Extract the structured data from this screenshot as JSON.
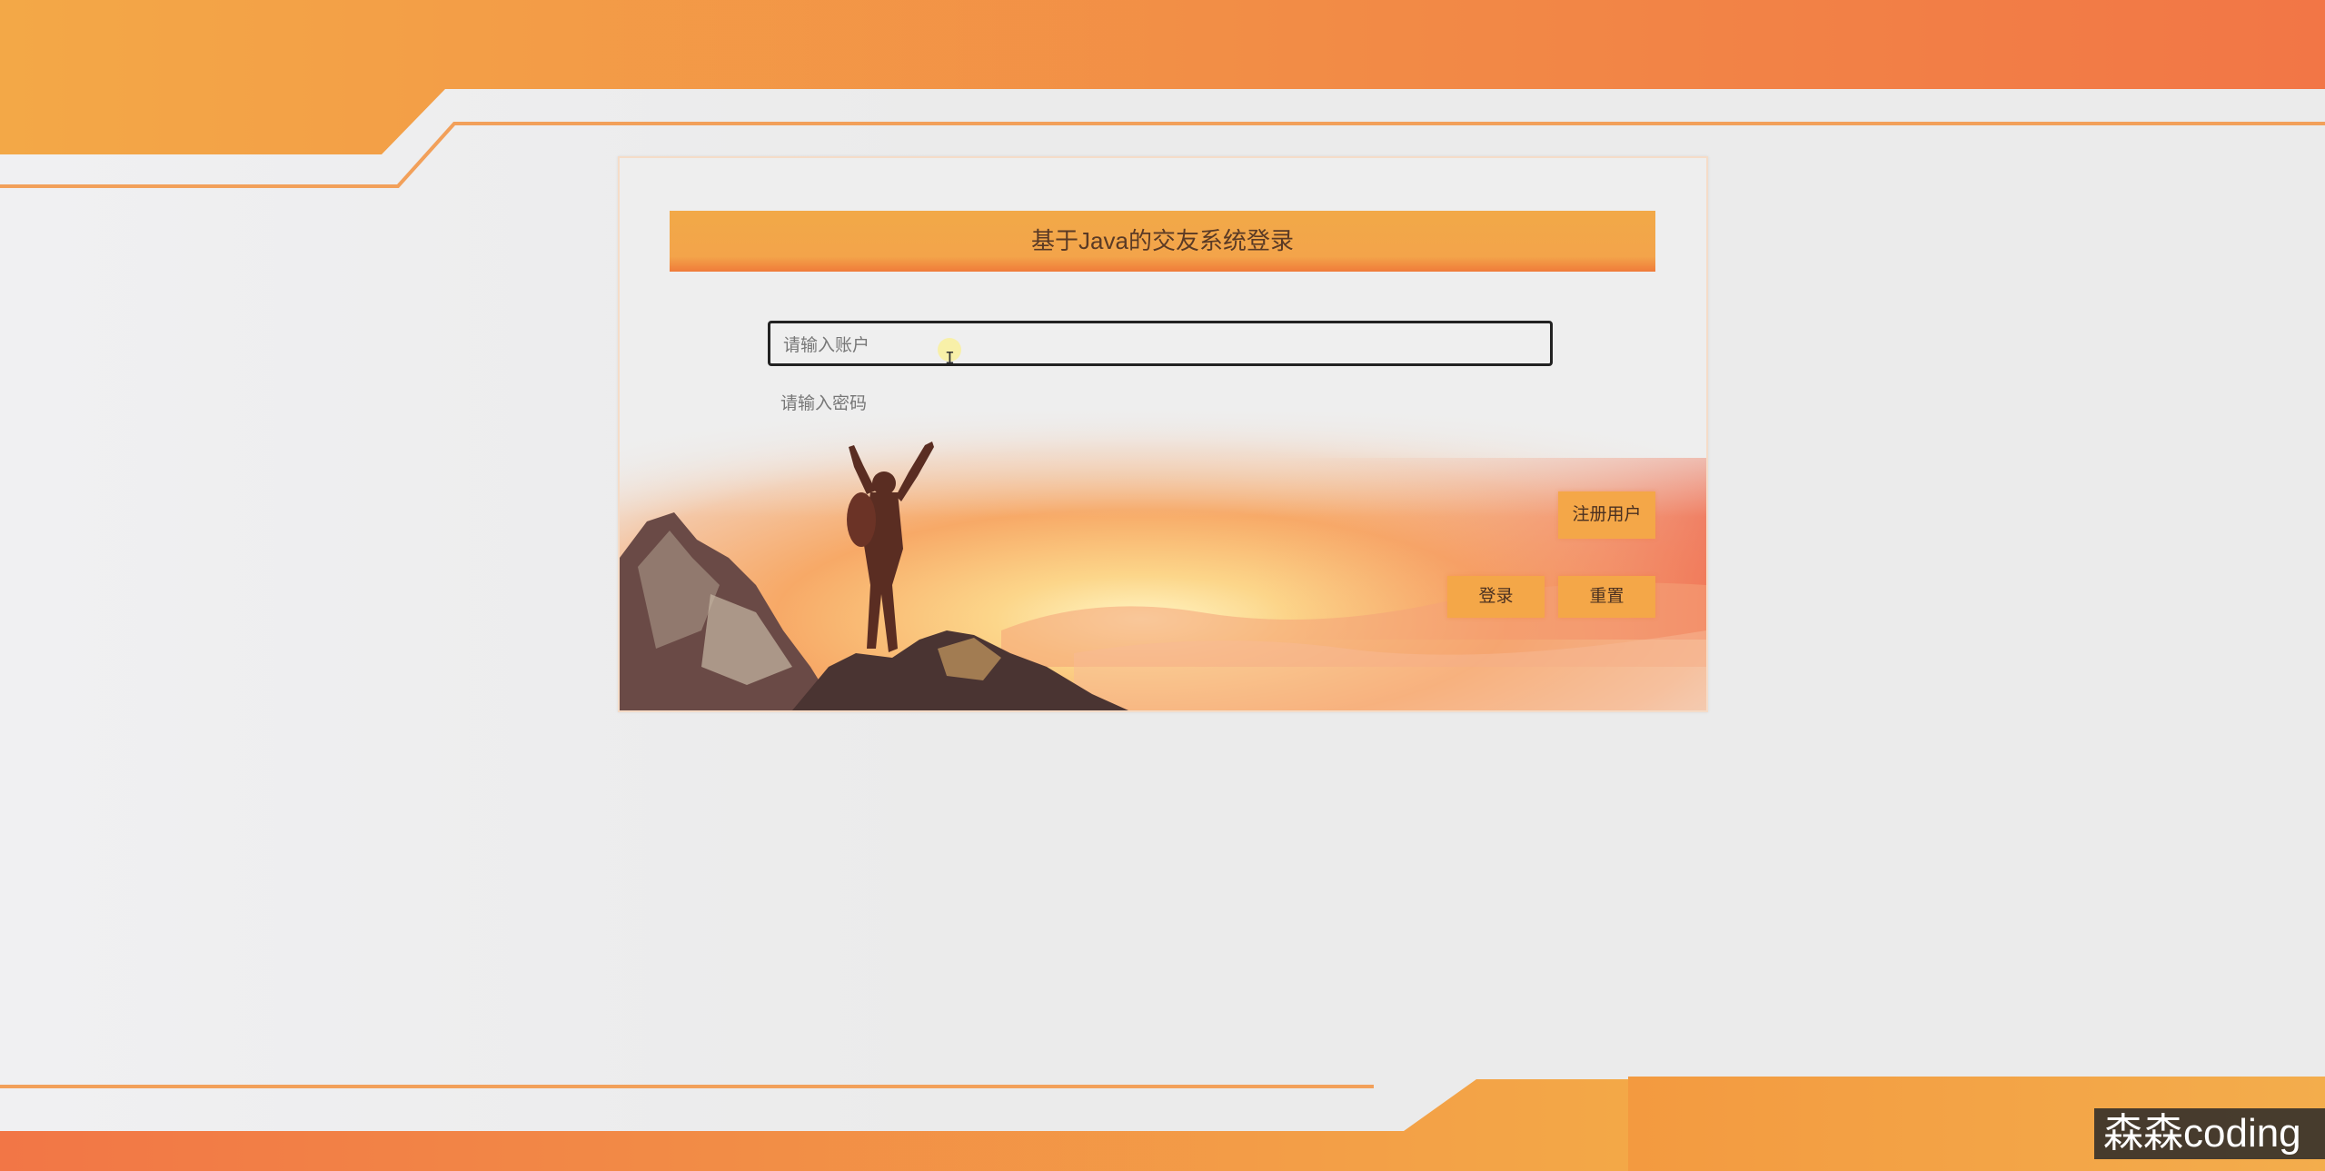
{
  "login": {
    "title": "基于Java的交友系统登录",
    "username_placeholder": "请输入账户",
    "password_placeholder": "请输入密码",
    "register_label": "注册用户",
    "login_label": "登录",
    "reset_label": "重置"
  },
  "overlay": {
    "watermark": "森森coding"
  },
  "colors": {
    "accent": "#f2a948",
    "accent_dark": "#f07b3a",
    "background": "#ebebeb"
  }
}
